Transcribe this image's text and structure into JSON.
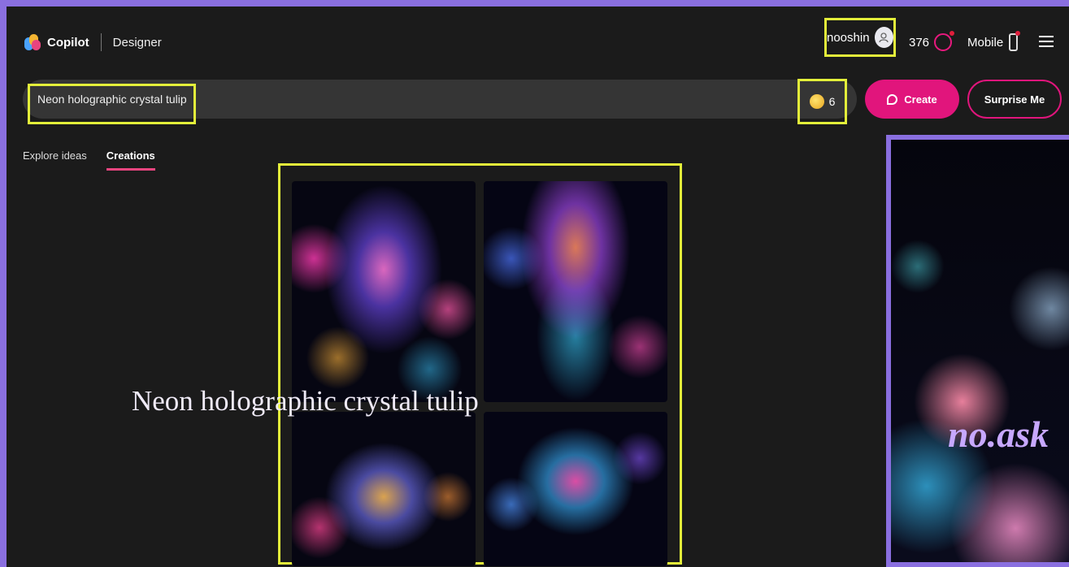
{
  "header": {
    "brand": "Copilot",
    "product": "Designer",
    "username": "nooshin",
    "rewards_points": "376",
    "mobile_label": "Mobile"
  },
  "prompt": {
    "value": "Neon holographic crystal tulip",
    "boost_count": "6"
  },
  "actions": {
    "create_label": "Create",
    "surprise_label": "Surprise Me"
  },
  "tabs": [
    {
      "label": "Explore ideas",
      "active": false
    },
    {
      "label": "Creations",
      "active": true
    }
  ],
  "overlay_caption": "Neon holographic crystal tulip",
  "preview": {
    "watermark": "no.ask"
  },
  "colors": {
    "accent": "#e1157c",
    "highlight": "#e3ef3a",
    "frame": "#8a6fe0",
    "background": "#1b1b1b"
  }
}
